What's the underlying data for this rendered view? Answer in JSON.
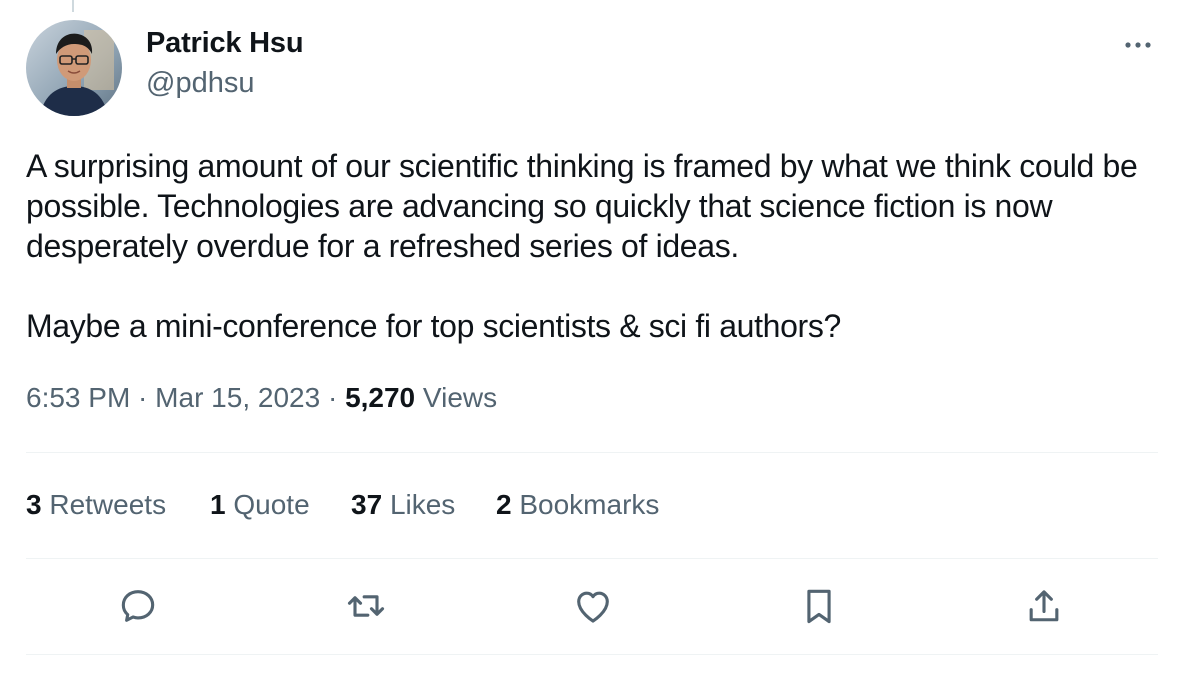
{
  "author": {
    "display_name": "Patrick Hsu",
    "handle": "@pdhsu"
  },
  "tweet": {
    "paragraph_1": "A surprising amount of our scientific thinking is framed by what we think could be possible. Technologies are advancing so quickly that science fiction is now desperately overdue for a refreshed series of ideas.",
    "paragraph_2": "Maybe a mini-conference for top scientists & sci fi authors?"
  },
  "meta": {
    "time": "6:53 PM",
    "separator": " · ",
    "date": "Mar 15, 2023",
    "views_count": "5,270",
    "views_label": "Views"
  },
  "stats": {
    "retweets": {
      "count": "3",
      "label": "Retweets"
    },
    "quotes": {
      "count": "1",
      "label": "Quote"
    },
    "likes": {
      "count": "37",
      "label": "Likes"
    },
    "bookmarks": {
      "count": "2",
      "label": "Bookmarks"
    }
  },
  "icons": {
    "more": "more-horizontal-icon",
    "reply": "reply-icon",
    "retweet": "retweet-icon",
    "like": "heart-icon",
    "bookmark": "bookmark-icon",
    "share": "share-icon"
  },
  "colors": {
    "text": "#0f1419",
    "secondary_text": "#536471",
    "divider": "#eff3f4",
    "icon": "#536471"
  }
}
